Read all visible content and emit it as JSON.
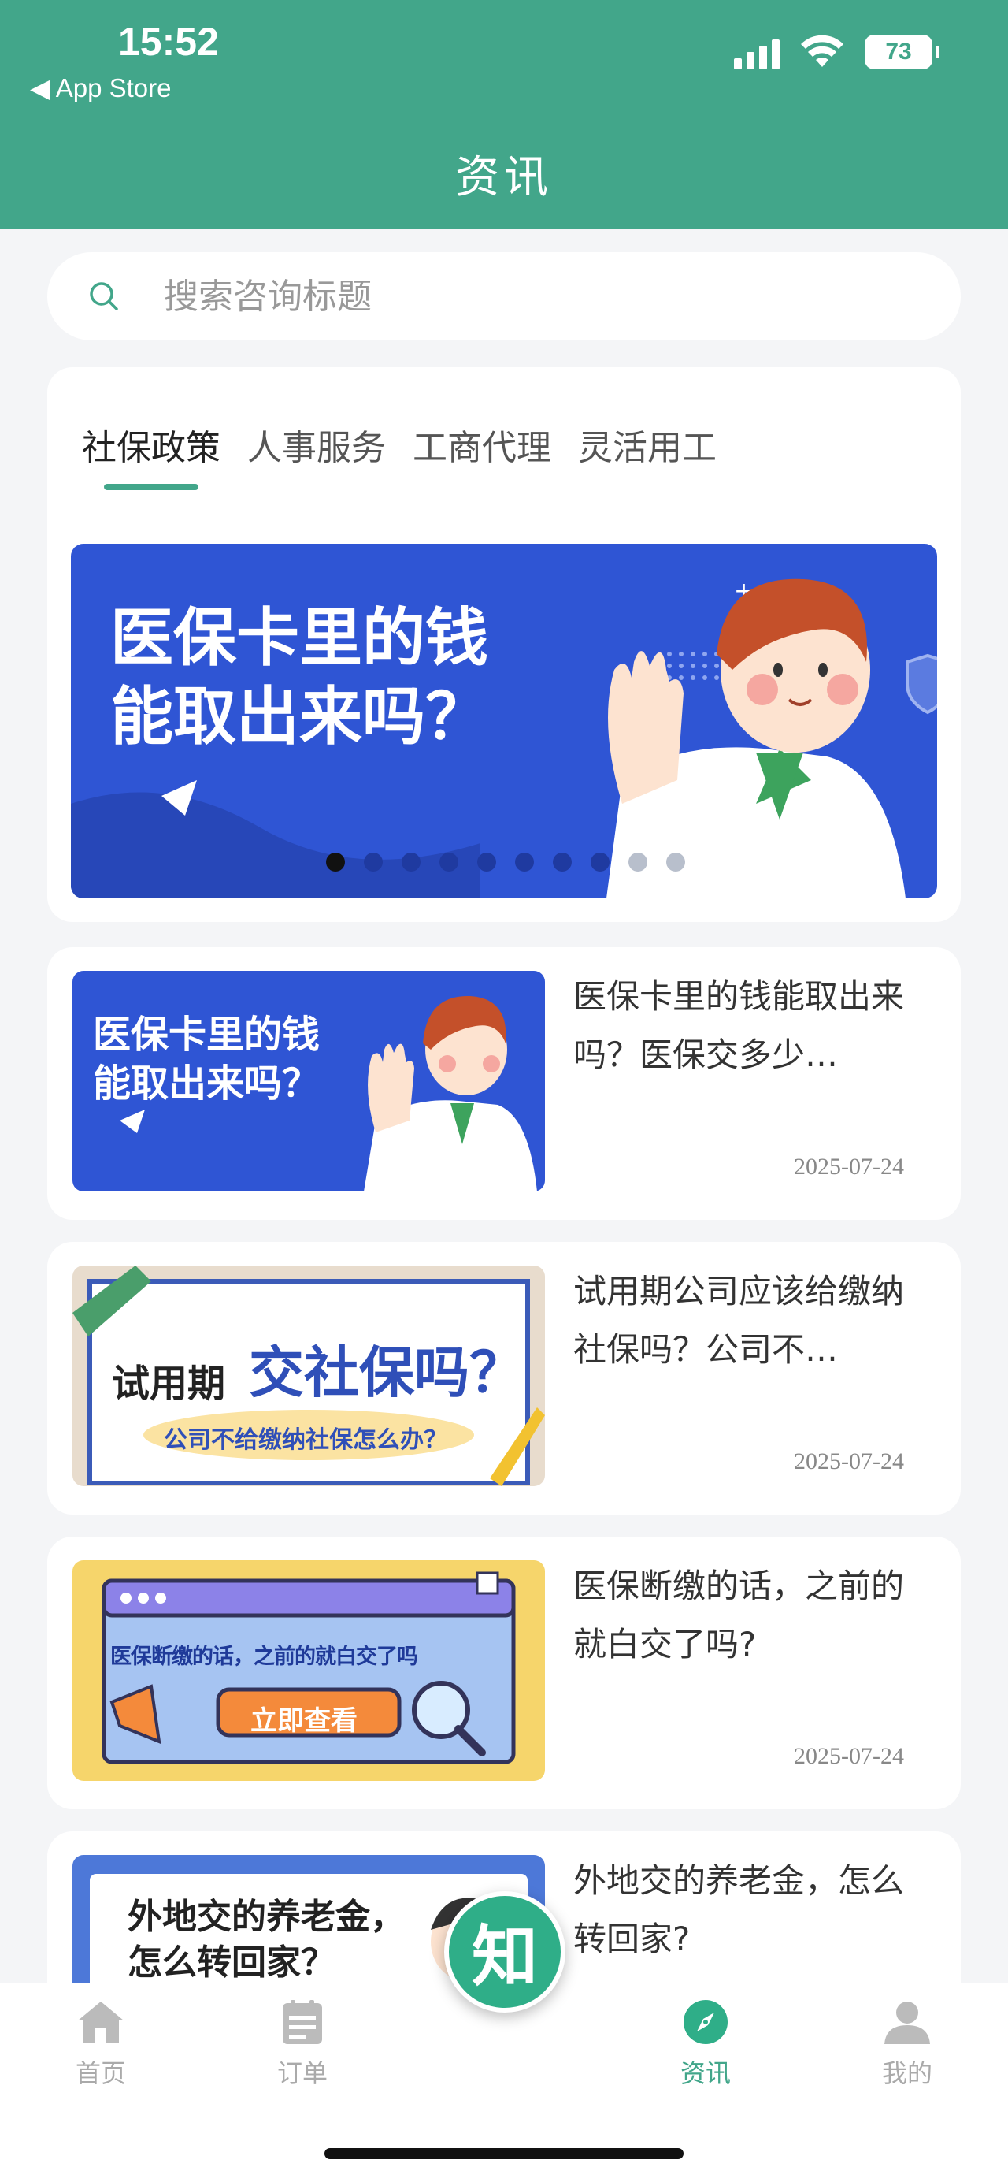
{
  "status_bar": {
    "time": "15:52",
    "back_app": "◀ App Store",
    "battery": "73"
  },
  "header": {
    "title": "资讯"
  },
  "search": {
    "placeholder": "搜索咨询标题",
    "value": ""
  },
  "categories": {
    "tabs": [
      "社保政策",
      "人事服务",
      "工商代理",
      "灵活用工"
    ],
    "active_index": 0
  },
  "banner": {
    "line1": "医保卡里的钱",
    "line2": "能取出来吗？",
    "dot_count": 10,
    "active_dot": 0
  },
  "news": [
    {
      "title": "医保卡里的钱能取出来吗？医保交多少…",
      "date": "2025-07-24",
      "thumb_line1": "医保卡里的钱",
      "thumb_line2": "能取出来吗？"
    },
    {
      "title": "试用期公司应该给缴纳社保吗？公司不…",
      "date": "2025-07-24",
      "thumb_tag": "试用期",
      "thumb_main": "交社保吗？",
      "thumb_sub": "公司不给缴纳社保怎么办？"
    },
    {
      "title": "医保断缴的话，之前的就白交了吗?",
      "date": "2025-07-24",
      "thumb_headline": "医保断缴的话，之前的就白交了吗",
      "thumb_button": "立即查看"
    },
    {
      "title": "外地交的养老金，怎么转回家?",
      "thumb_line1": "外地交的养老金，",
      "thumb_line2": "怎么转回家？"
    }
  ],
  "fab": {
    "label": "知"
  },
  "tabbar": {
    "items": [
      {
        "label": "首页",
        "icon": "home-icon"
      },
      {
        "label": "订单",
        "icon": "order-icon"
      },
      {
        "label": "资讯",
        "icon": "compass-icon"
      },
      {
        "label": "我的",
        "icon": "user-icon"
      }
    ],
    "active_index": 2
  },
  "colors": {
    "brand": "#42a68a",
    "banner_blue": "#2f55d4",
    "active_tab": "#42a68a"
  }
}
